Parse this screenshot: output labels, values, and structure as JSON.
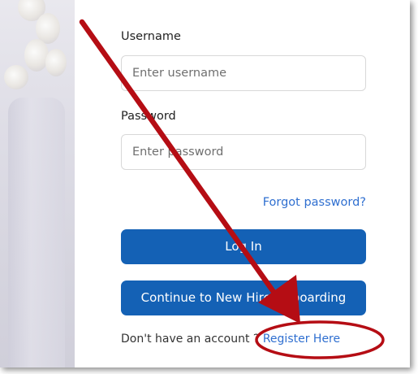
{
  "form": {
    "username_label": "Username",
    "username_placeholder": "Enter username",
    "username_value": "",
    "password_label": "Password",
    "password_placeholder": "Enter password",
    "password_value": "",
    "forgot_link": "Forgot password?",
    "login_button": "Log In",
    "onboarding_button": "Continue to New Hire Onboarding",
    "signup_prompt": "Don't have an account ?",
    "register_link": "Register Here"
  },
  "colors": {
    "primary_button": "#1461b5",
    "link": "#2f6fd0",
    "annotation_red": "#b50d14"
  },
  "annotation": {
    "arrow_icon": "red-arrow",
    "highlight_icon": "red-ellipse"
  }
}
